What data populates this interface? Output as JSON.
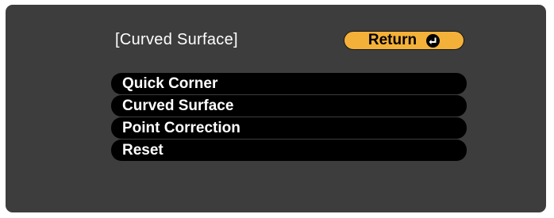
{
  "screen": {
    "title": "[Curved Surface]"
  },
  "return_button": {
    "label": "Return",
    "icon": "enter-icon"
  },
  "menu": {
    "items": [
      {
        "label": "Quick Corner"
      },
      {
        "label": "Curved Surface"
      },
      {
        "label": "Point Correction"
      },
      {
        "label": "Reset"
      }
    ]
  },
  "colors": {
    "panel_background": "#3d3d3d",
    "menu_item_background": "#000000",
    "return_button_background": "#f4b13a",
    "text": "#ffffff"
  }
}
